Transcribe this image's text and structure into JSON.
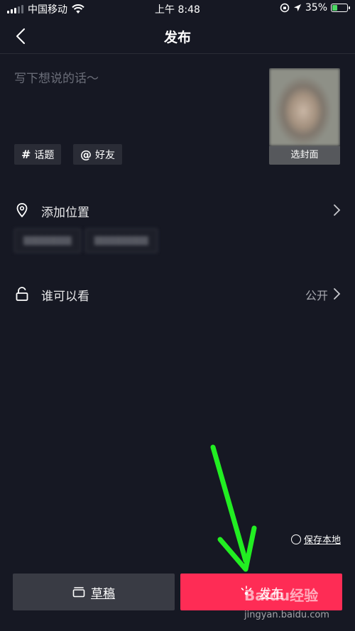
{
  "status_bar": {
    "carrier": "中国移动",
    "time": "上午 8:48",
    "battery": "35%",
    "battery_level": 0.35
  },
  "nav": {
    "title": "发布"
  },
  "caption": {
    "placeholder": "写下想说的话～",
    "value": ""
  },
  "cover": {
    "label": "选封面"
  },
  "tags": [
    {
      "glyph": "#",
      "label": "话题"
    },
    {
      "glyph": "@",
      "label": "好友"
    }
  ],
  "location": {
    "label": "添加位置",
    "icon": "location-pin-icon"
  },
  "privacy": {
    "label": "谁可以看",
    "value": "公开",
    "icon": "lock-icon"
  },
  "save_local": {
    "label": "保存本地"
  },
  "buttons": {
    "draft": "草稿",
    "publish": "发布"
  },
  "watermark": {
    "text": "Baidu经验",
    "url_text": "jingyan.baidu.com"
  },
  "colors": {
    "background": "#161823",
    "publish": "#fe2c55",
    "draft": "#393b44",
    "arrow": "#22ee22"
  }
}
